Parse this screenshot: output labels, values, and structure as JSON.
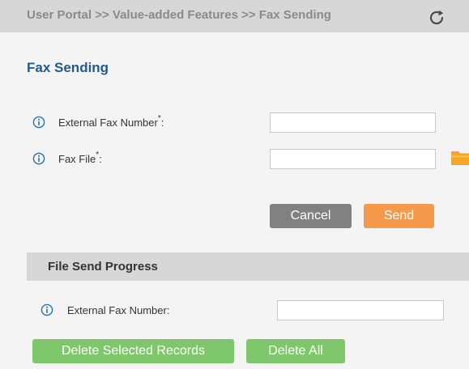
{
  "breadcrumb": {
    "text": "User Portal >> Value-added Features >> Fax Sending",
    "refresh_icon": "refresh-icon"
  },
  "page": {
    "title": "Fax Sending"
  },
  "form": {
    "external_fax_number": {
      "label": "External Fax Number",
      "required_mark": "*",
      "suffix": ":",
      "value": "",
      "info_icon": "info-icon"
    },
    "fax_file": {
      "label": "Fax File",
      "required_mark": "*",
      "suffix": ":",
      "value": "",
      "info_icon": "info-icon",
      "browse_icon": "folder-icon"
    },
    "cancel_label": "Cancel",
    "send_label": "Send"
  },
  "progress": {
    "title": "File Send Progress",
    "external_fax_number_label": "External Fax Number:",
    "external_fax_number_value": "",
    "delete_selected_label": "Delete Selected Records",
    "delete_all_label": "Delete All"
  },
  "colors": {
    "title_blue": "#235a8c",
    "send_orange": "#f49a4a",
    "cancel_gray": "#818181",
    "delete_green": "#7ec76b",
    "folder_orange": "#f5a623",
    "bar_gray": "#d7d7d7",
    "info_blue": "#2c6fa8"
  }
}
